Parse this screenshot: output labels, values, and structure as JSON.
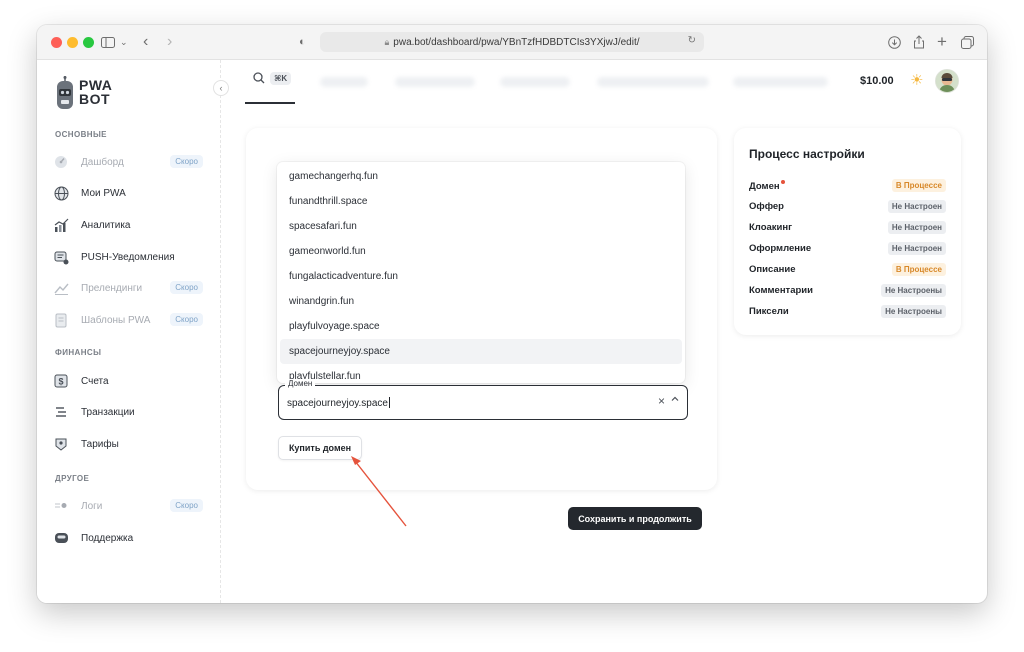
{
  "browser": {
    "url": "pwa.bot/dashboard/pwa/YBnTzfHDBDTCIs3YXjwJ/edit/"
  },
  "logo": {
    "line1": "PWA",
    "line2": "BOT"
  },
  "sidebar": {
    "sections": [
      {
        "title": "ОСНОВНЫЕ"
      },
      {
        "title": "ФИНАНСЫ"
      },
      {
        "title": "ДРУГОЕ"
      }
    ],
    "items": [
      {
        "label": "Дашборд",
        "badge": "Скоро",
        "icon": "dashboard-icon"
      },
      {
        "label": "Мои PWA",
        "icon": "globe-icon"
      },
      {
        "label": "Аналитика",
        "icon": "chart-icon"
      },
      {
        "label": "PUSH-Уведомления",
        "icon": "push-icon"
      },
      {
        "label": "Прелендинги",
        "badge": "Скоро",
        "icon": "landing-icon"
      },
      {
        "label": "Шаблоны PWA",
        "badge": "Скоро",
        "icon": "template-icon"
      },
      {
        "label": "Счета",
        "icon": "invoice-icon"
      },
      {
        "label": "Транзакции",
        "icon": "transactions-icon"
      },
      {
        "label": "Тарифы",
        "icon": "tariff-icon"
      },
      {
        "label": "Логи",
        "badge": "Скоро",
        "icon": "logs-icon"
      },
      {
        "label": "Поддержка",
        "icon": "support-icon"
      }
    ]
  },
  "header": {
    "search_shortcut": "⌘K",
    "balance": "$10.00"
  },
  "domain_dropdown": {
    "options": [
      "gamechangerhq.fun",
      "funandthrill.space",
      "spacesafari.fun",
      "gameonworld.fun",
      "fungalacticadventure.fun",
      "winandgrin.fun",
      "playfulvoyage.space",
      "spacejourneyjoy.space",
      "playfulstellar.fun"
    ],
    "selected_index": 7
  },
  "domain_field": {
    "label": "Домен",
    "value": "spacejourneyjoy.space"
  },
  "buttons": {
    "buy_domain": "Купить домен",
    "save_continue": "Сохранить и продолжить"
  },
  "setup_progress": {
    "title": "Процесс настройки",
    "steps": [
      {
        "label": "Домен",
        "status": "В Процессе",
        "state": "in_progress",
        "alert_dot": true
      },
      {
        "label": "Оффер",
        "status": "Не Настроен",
        "state": "not_set"
      },
      {
        "label": "Клоакинг",
        "status": "Не Настроен",
        "state": "not_set"
      },
      {
        "label": "Оформление",
        "status": "Не Настроен",
        "state": "not_set"
      },
      {
        "label": "Описание",
        "status": "В Процессе",
        "state": "in_progress"
      },
      {
        "label": "Комментарии",
        "status": "Не Настроены",
        "state": "not_set"
      },
      {
        "label": "Пиксели",
        "status": "Не Настроены",
        "state": "not_set"
      }
    ]
  },
  "colors": {
    "accent_dark": "#24282e",
    "status_in_progress": "#d8892a",
    "annotation_arrow": "#e5533c"
  }
}
